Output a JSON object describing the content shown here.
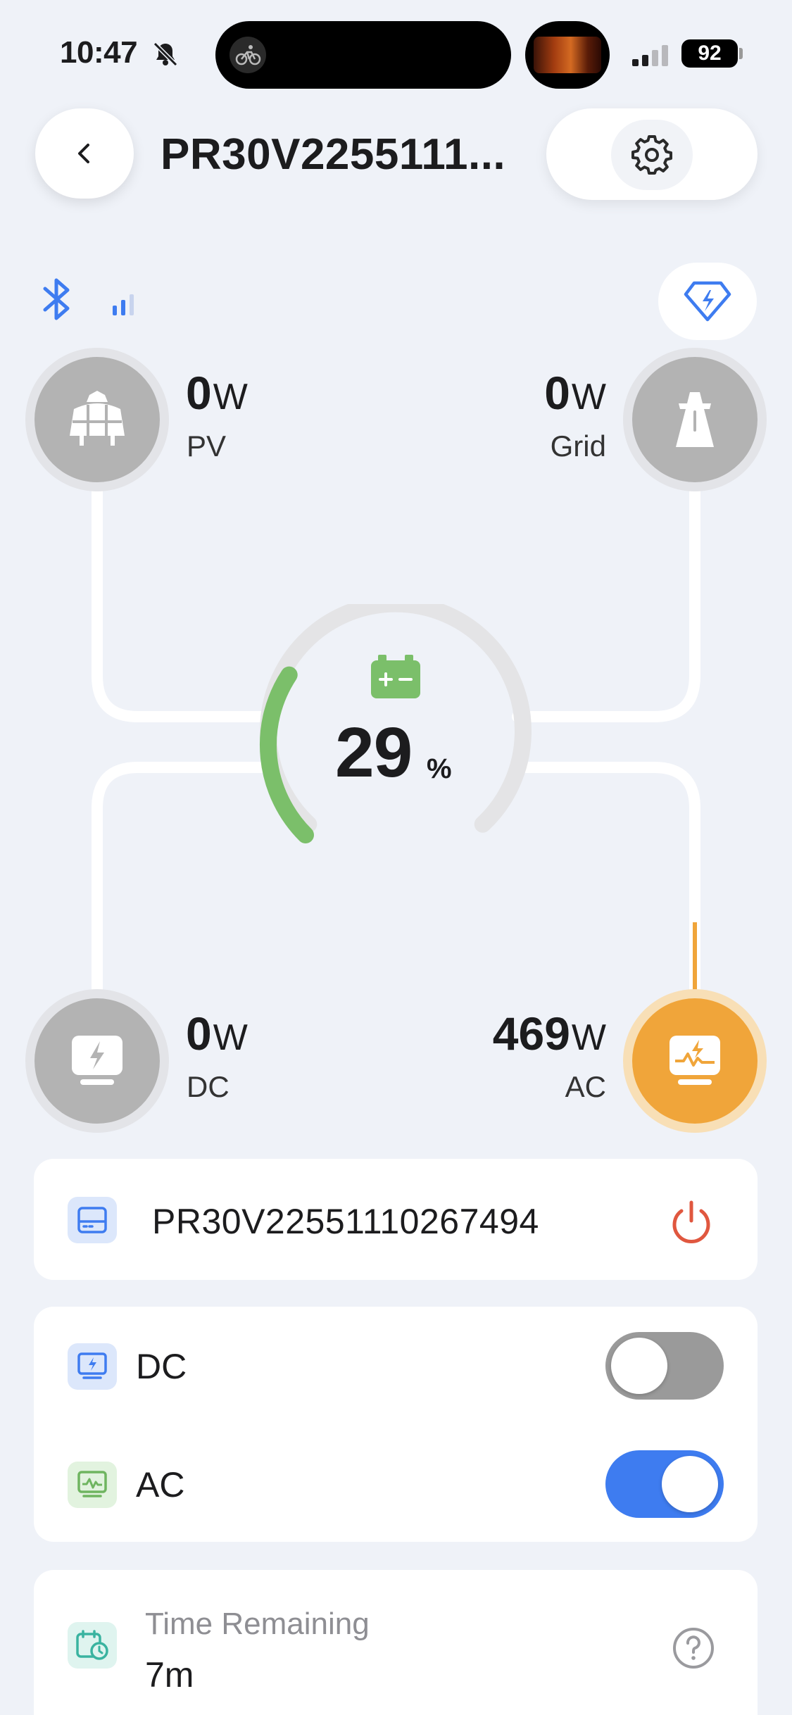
{
  "status_bar": {
    "time": "10:47",
    "battery": "92",
    "icons": [
      "bell-slash-icon",
      "cycling-activity-icon",
      "cellular-signal-icon",
      "battery-icon"
    ]
  },
  "header": {
    "title": "PR30V2255111...",
    "back_icon": "chevron-left-icon",
    "settings_icon": "gear-icon"
  },
  "connectivity": {
    "bluetooth_icon": "bluetooth-icon",
    "signal_icon": "signal-bars-icon",
    "premium_icon": "diamond-bolt-icon"
  },
  "energy_flow": {
    "pv": {
      "value": "0",
      "unit": "W",
      "label": "PV",
      "icon": "solar-panel-icon",
      "active": false
    },
    "grid": {
      "value": "0",
      "unit": "W",
      "label": "Grid",
      "icon": "power-tower-icon",
      "active": false
    },
    "dc": {
      "value": "0",
      "unit": "W",
      "label": "DC",
      "icon": "dc-output-icon",
      "active": false
    },
    "ac": {
      "value": "469",
      "unit": "W",
      "label": "AC",
      "icon": "ac-output-icon",
      "active": true
    },
    "battery": {
      "percent": "29",
      "unit": "%",
      "level": 0.29,
      "icon": "battery-icon"
    }
  },
  "device": {
    "name": "PR30V22551110267494",
    "icon": "device-icon",
    "power_icon": "power-icon"
  },
  "outputs": [
    {
      "label": "DC",
      "icon": "dc-screen-icon",
      "on": false
    },
    {
      "label": "AC",
      "icon": "ac-screen-icon",
      "on": true
    }
  ],
  "time_remaining": {
    "label": "Time Remaining",
    "value": "7m",
    "icon": "calendar-clock-icon",
    "help_icon": "question-icon"
  },
  "colors": {
    "accent_blue": "#3e7cf0",
    "orange": "#f0a53a",
    "green": "#7bbf6a",
    "power_red": "#e0573f",
    "background": "#eff2f8"
  }
}
